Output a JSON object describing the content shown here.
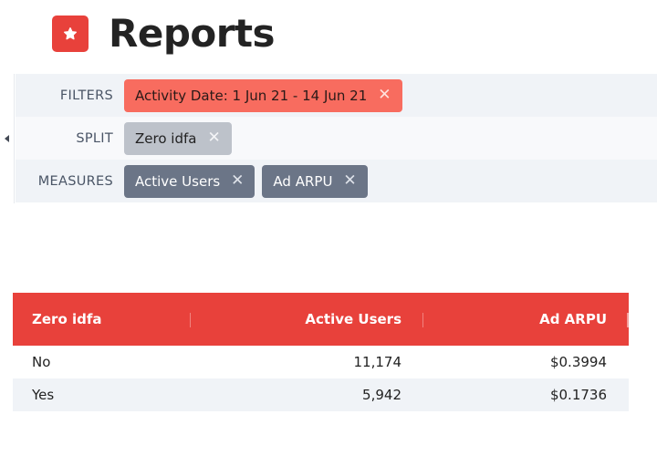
{
  "header": {
    "title": "Reports",
    "logo_icon": "star-icon",
    "accent_color": "#e8413b"
  },
  "panel": {
    "collapse_icon": "caret-left-icon",
    "filters": {
      "label": "FILTERS",
      "chips": [
        {
          "label": "Activity Date: 1 Jun 21 - 14 Jun 21",
          "remove_icon": "close-icon"
        }
      ]
    },
    "split": {
      "label": "SPLIT",
      "chips": [
        {
          "label": "Zero idfa",
          "remove_icon": "close-icon"
        }
      ]
    },
    "measures": {
      "label": "MEASURES",
      "chips": [
        {
          "label": "Active Users",
          "remove_icon": "close-icon"
        },
        {
          "label": "Ad ARPU",
          "remove_icon": "close-icon"
        }
      ]
    }
  },
  "table": {
    "columns": [
      "Zero idfa",
      "Active Users",
      "Ad ARPU"
    ],
    "rows": [
      [
        "No",
        "11,174",
        "$0.3994"
      ],
      [
        "Yes",
        "5,942",
        "$0.1736"
      ]
    ]
  },
  "close_glyph": "✕"
}
